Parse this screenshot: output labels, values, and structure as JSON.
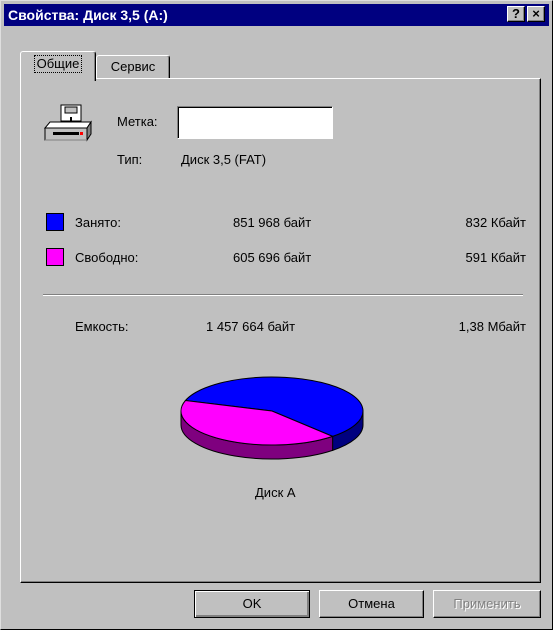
{
  "window": {
    "title": "Свойства: Диск 3,5 (A:)",
    "help_label": "?",
    "close_label": "×"
  },
  "tabs": [
    {
      "label": "Общие",
      "active": true
    },
    {
      "label": "Сервис",
      "active": false
    }
  ],
  "general": {
    "label_caption": "Метка:",
    "label_value": "",
    "type_caption": "Тип:",
    "type_value": "Диск 3,5 (FAT)",
    "used": {
      "caption": "Занято:",
      "bytes": "851 968 байт",
      "short": "832 Кбайт",
      "color": "#0000ff"
    },
    "free": {
      "caption": "Свободно:",
      "bytes": "605 696 байт",
      "short": "591 Кбайт",
      "color": "#ff00ff"
    },
    "capacity": {
      "caption": "Емкость:",
      "bytes": "1 457 664 байт",
      "short": "1,38 Мбайт"
    },
    "pie": {
      "label": "Диск А",
      "used_fraction": 0.584
    }
  },
  "buttons": {
    "ok": "OK",
    "cancel": "Отмена",
    "apply": "Применить"
  }
}
